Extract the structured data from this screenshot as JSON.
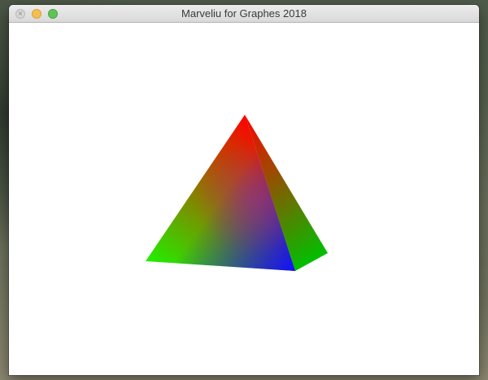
{
  "window": {
    "title": "Marveliu for Graphes 2018",
    "close_glyph": "×"
  },
  "icons": {
    "close": "close-icon",
    "minimize": "minimize-icon",
    "maximize": "maximize-icon"
  },
  "scene": {
    "object": "tetrahedron",
    "vertex_colors": [
      "#ff0000",
      "#00ff00",
      "#0000ff"
    ]
  }
}
